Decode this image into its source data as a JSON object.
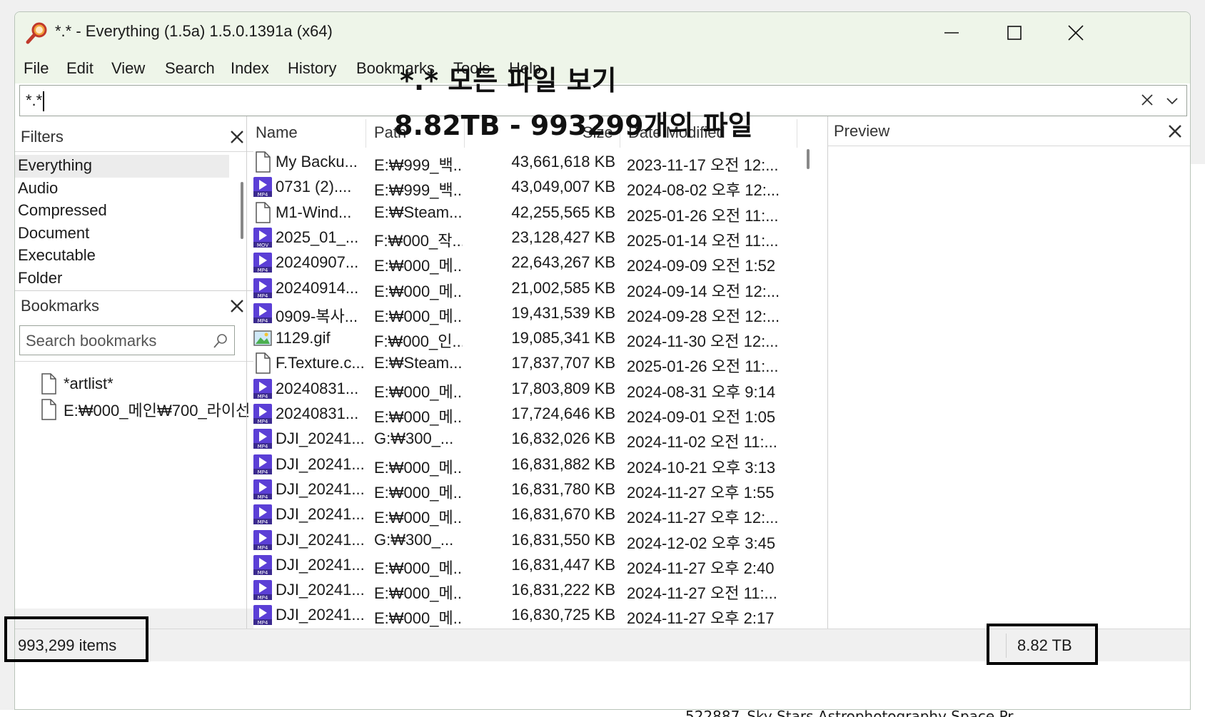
{
  "window": {
    "title": "*.* - Everything (1.5a) 1.5.0.1391a (x64)"
  },
  "menu": [
    "File",
    "Edit",
    "View",
    "Search",
    "Index",
    "History",
    "Bookmarks",
    "Tools",
    "Help"
  ],
  "search": {
    "value": "*.*"
  },
  "overlay": {
    "line1": "*.* 모든 파일 보기",
    "line2": "8.82TB - 993299개의 파일"
  },
  "filters": {
    "title": "Filters",
    "items": [
      "Everything",
      "Audio",
      "Compressed",
      "Document",
      "Executable",
      "Folder"
    ]
  },
  "bookmarks": {
    "title": "Bookmarks",
    "search_placeholder": "Search bookmarks",
    "items": [
      "*artlist*",
      "E:₩000_메인₩700_라이선"
    ]
  },
  "columns": {
    "name": "Name",
    "path": "Path",
    "size": "Size",
    "date": "Date Modified"
  },
  "rows": [
    {
      "icon": "document",
      "name": "My Backu...",
      "path": "E:₩999_백...",
      "size": "43,661,618 KB",
      "date": "2023-11-17 오전 12:..."
    },
    {
      "icon": "mp4",
      "name": "0731 (2)....",
      "path": "E:₩999_백...",
      "size": "43,049,007 KB",
      "date": "2024-08-02 오후 12:..."
    },
    {
      "icon": "document",
      "name": "M1-Wind...",
      "path": "E:₩Steam...",
      "size": "42,255,565 KB",
      "date": "2025-01-26 오전 11:..."
    },
    {
      "icon": "mov",
      "name": "2025_01_...",
      "path": "F:₩000_작...",
      "size": "23,128,427 KB",
      "date": "2025-01-14 오전 11:..."
    },
    {
      "icon": "mp4",
      "name": "20240907...",
      "path": "E:₩000_메...",
      "size": "22,643,267 KB",
      "date": "2024-09-09 오전 1:52"
    },
    {
      "icon": "mp4",
      "name": "20240914...",
      "path": "E:₩000_메...",
      "size": "21,002,585 KB",
      "date": "2024-09-14 오전 12:..."
    },
    {
      "icon": "mp4",
      "name": "0909-복사...",
      "path": "E:₩000_메...",
      "size": "19,431,539 KB",
      "date": "2024-09-28 오전 12:..."
    },
    {
      "icon": "image",
      "name": "1129.gif",
      "path": "F:₩000_인...",
      "size": "19,085,341 KB",
      "date": "2024-11-30 오전 12:..."
    },
    {
      "icon": "document",
      "name": "F.Texture.c...",
      "path": "E:₩Steam...",
      "size": "17,837,707 KB",
      "date": "2025-01-26 오전 11:..."
    },
    {
      "icon": "mp4",
      "name": "20240831...",
      "path": "E:₩000_메...",
      "size": "17,803,809 KB",
      "date": "2024-08-31 오후 9:14"
    },
    {
      "icon": "mp4",
      "name": "20240831...",
      "path": "E:₩000_메...",
      "size": "17,724,646 KB",
      "date": "2024-09-01 오전 1:05"
    },
    {
      "icon": "mp4",
      "name": "DJI_20241...",
      "path": "G:₩300_...",
      "size": "16,832,026 KB",
      "date": "2024-11-02 오전 11:..."
    },
    {
      "icon": "mp4",
      "name": "DJI_20241...",
      "path": "E:₩000_메...",
      "size": "16,831,882 KB",
      "date": "2024-10-21 오후 3:13"
    },
    {
      "icon": "mp4",
      "name": "DJI_20241...",
      "path": "E:₩000_메...",
      "size": "16,831,780 KB",
      "date": "2024-11-27 오후 1:55"
    },
    {
      "icon": "mp4",
      "name": "DJI_20241...",
      "path": "E:₩000_메...",
      "size": "16,831,670 KB",
      "date": "2024-11-27 오후 12:..."
    },
    {
      "icon": "mp4",
      "name": "DJI_20241...",
      "path": "G:₩300_...",
      "size": "16,831,550 KB",
      "date": "2024-12-02 오후 3:45"
    },
    {
      "icon": "mp4",
      "name": "DJI_20241...",
      "path": "E:₩000_메...",
      "size": "16,831,447 KB",
      "date": "2024-11-27 오후 2:40"
    },
    {
      "icon": "mp4",
      "name": "DJI_20241...",
      "path": "E:₩000_메...",
      "size": "16,831,222 KB",
      "date": "2024-11-27 오전 11:..."
    },
    {
      "icon": "mp4",
      "name": "DJI_20241...",
      "path": "E:₩000_메...",
      "size": "16,830,725 KB",
      "date": "2024-11-27 오후 2:17"
    }
  ],
  "preview": {
    "title": "Preview"
  },
  "status": {
    "items": "993,299 items",
    "size": "8.82 TB"
  },
  "background": {
    "bottom_text": "522887_Sky Stars Astrophotography Space Pr..."
  },
  "colors": {
    "titlebar": "#eef5e9",
    "mp4_icon": "#5b3fd6",
    "accent": "#1a1a1a"
  }
}
